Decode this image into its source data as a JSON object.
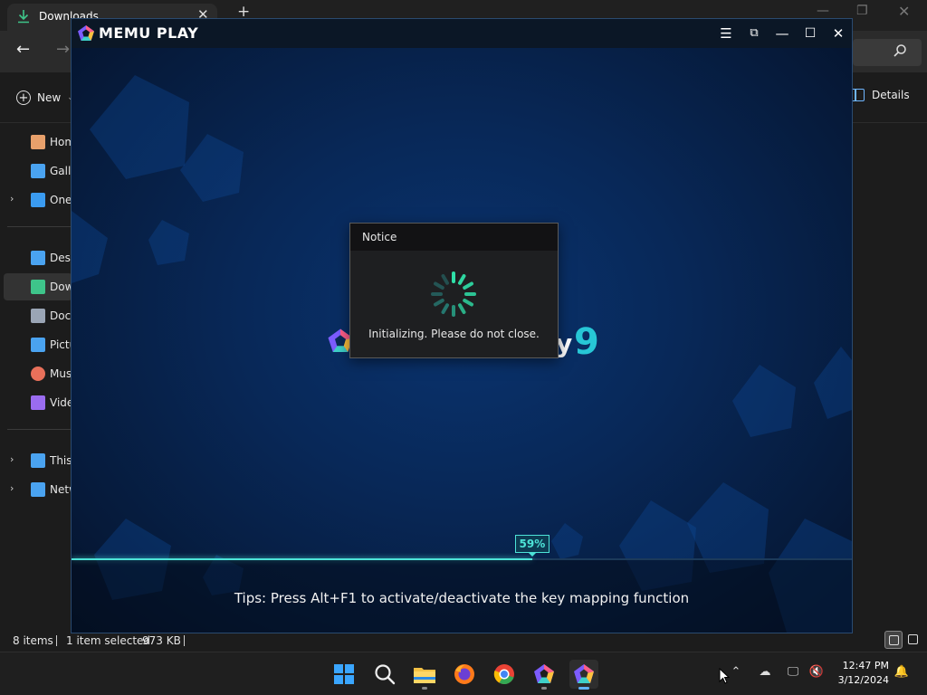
{
  "explorer": {
    "tab_title": "Downloads",
    "new_button_label": "New",
    "details_label": "Details",
    "sidebar": {
      "items": [
        {
          "label": "Home",
          "color": "#e8a06b"
        },
        {
          "label": "Gallery",
          "color": "#4aa3f0"
        },
        {
          "label": "OneDrive",
          "color": "#3a9bf0",
          "expandable": true
        },
        {
          "label": "Desktop",
          "color": "#4aa3f0"
        },
        {
          "label": "Downloads",
          "color": "#3ec48a",
          "selected": true
        },
        {
          "label": "Documents",
          "color": "#9aa5b5"
        },
        {
          "label": "Pictures",
          "color": "#4aa3f0"
        },
        {
          "label": "Music",
          "color": "#e8705a"
        },
        {
          "label": "Videos",
          "color": "#9a6cf0"
        },
        {
          "label": "This PC",
          "color": "#4aa3f0",
          "expandable": true
        },
        {
          "label": "Network",
          "color": "#4aa3f0",
          "expandable": true
        }
      ]
    },
    "status": {
      "items_count": "8 items",
      "selection": "1 item selected",
      "size": "973 KB"
    }
  },
  "memu": {
    "title": "MEMU PLAY",
    "notice": {
      "title": "Notice",
      "message": "Initializing. Please do not close."
    },
    "brand_version": "9",
    "progress": {
      "label": "59%",
      "value": 0.59
    },
    "tips": "Tips: Press Alt+F1 to activate/deactivate the key mapping function",
    "accent_color": "#4de3d8"
  },
  "taskbar": {
    "time": "12:47 PM",
    "date": "3/12/2024",
    "apps": [
      "start-icon",
      "search-icon",
      "file-explorer-icon",
      "firefox-icon",
      "chrome-icon",
      "memu-multi-icon",
      "memu-play-icon"
    ]
  }
}
